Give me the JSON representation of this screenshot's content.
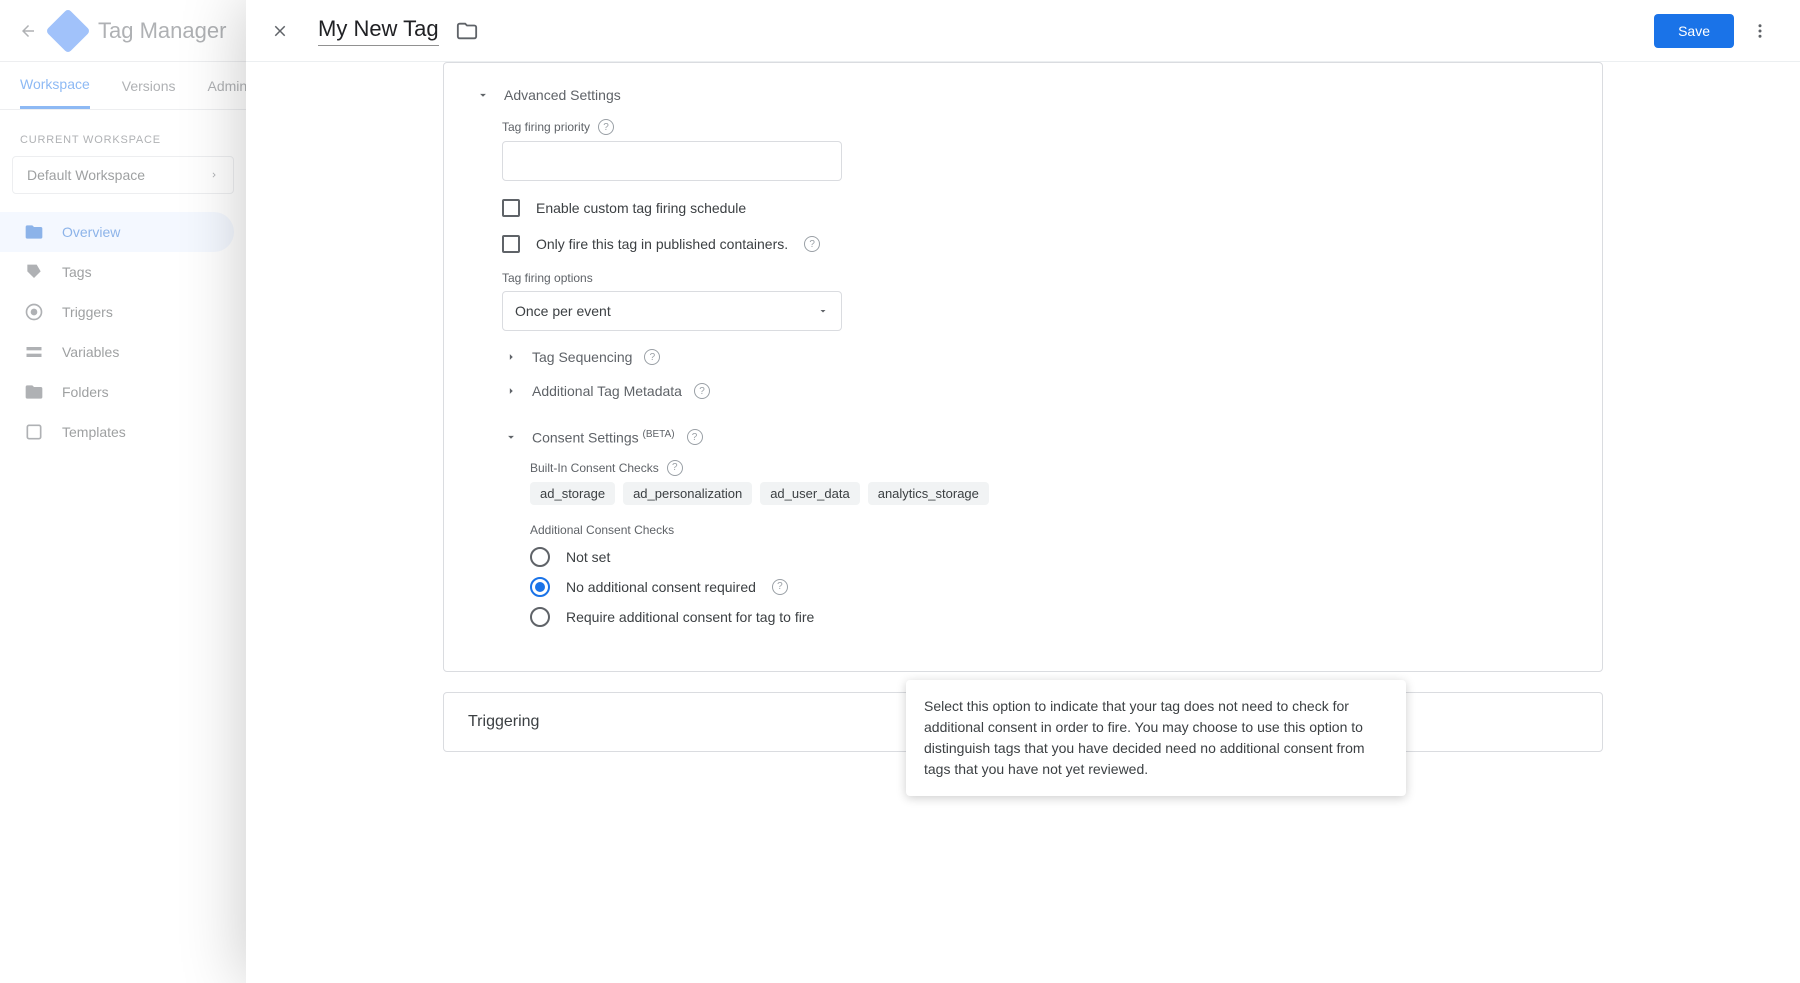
{
  "header": {
    "app_title": "Tag Manager"
  },
  "tabs": {
    "workspace": "Workspace",
    "versions": "Versions",
    "admin": "Admin"
  },
  "sidebar": {
    "current_workspace_label": "CURRENT WORKSPACE",
    "workspace_name": "Default Workspace",
    "items": [
      "Overview",
      "Tags",
      "Triggers",
      "Variables",
      "Folders",
      "Templates"
    ]
  },
  "panel": {
    "tag_name": "My New Tag",
    "save_label": "Save"
  },
  "adv": {
    "title": "Advanced Settings",
    "priority_label": "Tag firing priority",
    "enable_schedule": "Enable custom tag firing schedule",
    "only_published": "Only fire this tag in published containers.",
    "firing_options_label": "Tag firing options",
    "firing_options_value": "Once per event",
    "tag_sequencing": "Tag Sequencing",
    "additional_metadata": "Additional Tag Metadata",
    "consent_title": "Consent Settings ",
    "consent_beta": "(BETA)",
    "builtin_label": "Built-In Consent Checks",
    "chips": [
      "ad_storage",
      "ad_personalization",
      "ad_user_data",
      "analytics_storage"
    ],
    "additional_checks_label": "Additional Consent Checks",
    "radio": {
      "not_set": "Not set",
      "no_additional": "No additional consent required",
      "require_additional": "Require additional consent for tag to fire"
    },
    "tooltip": "Select this option to indicate that your tag does not need to check for additional consent in order to fire. You may choose to use this option to distinguish tags that you have decided need no additional consent from tags that you have not yet reviewed."
  },
  "triggering": {
    "title": "Triggering"
  }
}
